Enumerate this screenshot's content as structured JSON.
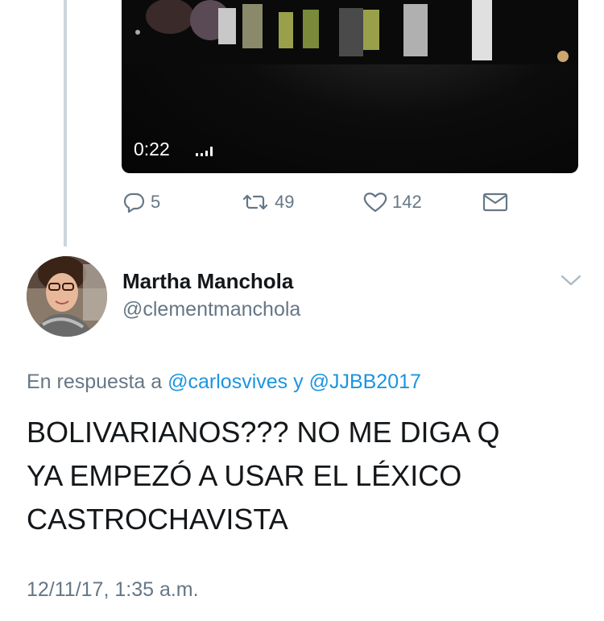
{
  "video": {
    "time": "0:22",
    "volume_icon": "volume-bars-icon"
  },
  "actions": {
    "reply_count": "5",
    "retweet_count": "49",
    "like_count": "142",
    "reply_icon": "reply-bubble-icon",
    "retweet_icon": "retweet-icon",
    "like_icon": "heart-icon",
    "dm_icon": "envelope-icon"
  },
  "reply_tweet": {
    "display_name": "Martha Manchola",
    "handle": "@clementmanchola",
    "replying_prefix": "En respuesta a",
    "mention_1": "@carlosvives",
    "joiner": "y",
    "mention_2": "@JJBB2017",
    "text_lines": [
      "BOLIVARIANOS??? NO ME DIGA Q",
      "YA EMPEZÓ A USAR EL LÉXICO",
      "CASTROCHAVISTA"
    ],
    "timestamp": "12/11/17, 1:35 a.m."
  },
  "colors": {
    "text_primary": "#14171a",
    "text_secondary": "#657786",
    "link": "#1b95e0",
    "thread_line": "#ccd6dd"
  }
}
